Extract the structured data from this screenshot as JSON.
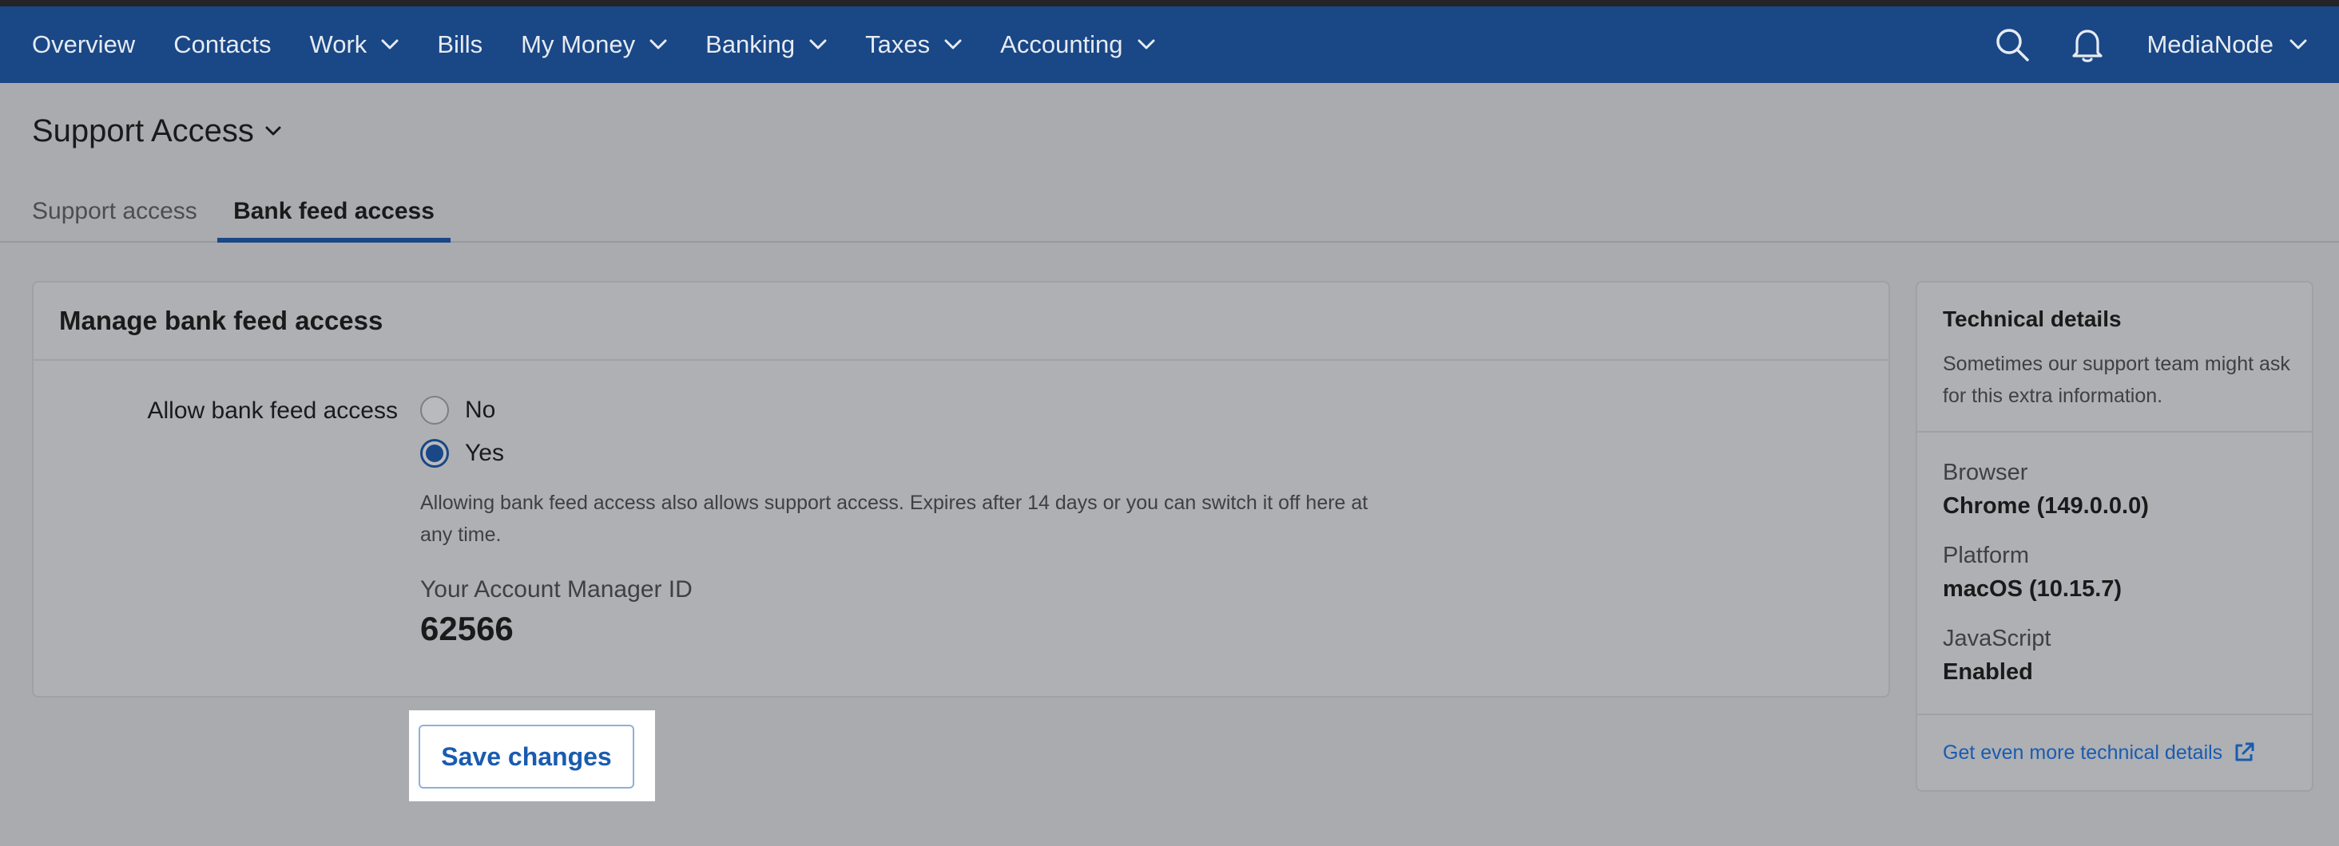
{
  "navbar": {
    "items": [
      {
        "label": "Overview",
        "has_dropdown": false
      },
      {
        "label": "Contacts",
        "has_dropdown": false
      },
      {
        "label": "Work",
        "has_dropdown": true
      },
      {
        "label": "Bills",
        "has_dropdown": false
      },
      {
        "label": "My Money",
        "has_dropdown": true
      },
      {
        "label": "Banking",
        "has_dropdown": true
      },
      {
        "label": "Taxes",
        "has_dropdown": true
      },
      {
        "label": "Accounting",
        "has_dropdown": true
      }
    ],
    "icons": [
      "search-icon",
      "bell-icon"
    ],
    "user_label": "MediaNode"
  },
  "page": {
    "title": "Support Access"
  },
  "tabs": [
    {
      "label": "Support access",
      "active": false
    },
    {
      "label": "Bank feed access",
      "active": true
    }
  ],
  "main_card": {
    "title": "Manage bank feed access",
    "field_label": "Allow bank feed access",
    "options": [
      {
        "label": "No",
        "checked": false
      },
      {
        "label": "Yes",
        "checked": true
      }
    ],
    "help_text": "Allowing bank feed access also allows support access. Expires after 14 days or you can switch it off here at any time.",
    "account_manager_label": "Your Account Manager ID",
    "account_manager_id": "62566"
  },
  "actions": {
    "save_label": "Save changes"
  },
  "technical_details": {
    "title": "Technical details",
    "description": "Sometimes our support team might ask for this extra information.",
    "items": [
      {
        "label": "Browser",
        "value": "Chrome (149.0.0.0)"
      },
      {
        "label": "Platform",
        "value": "macOS (10.15.7)"
      },
      {
        "label": "JavaScript",
        "value": "Enabled"
      }
    ],
    "link_label": "Get even more technical details"
  },
  "colors": {
    "navbar": "#1a4785",
    "accent": "#1a5bb0",
    "overlay_background": "#a9abaf"
  }
}
